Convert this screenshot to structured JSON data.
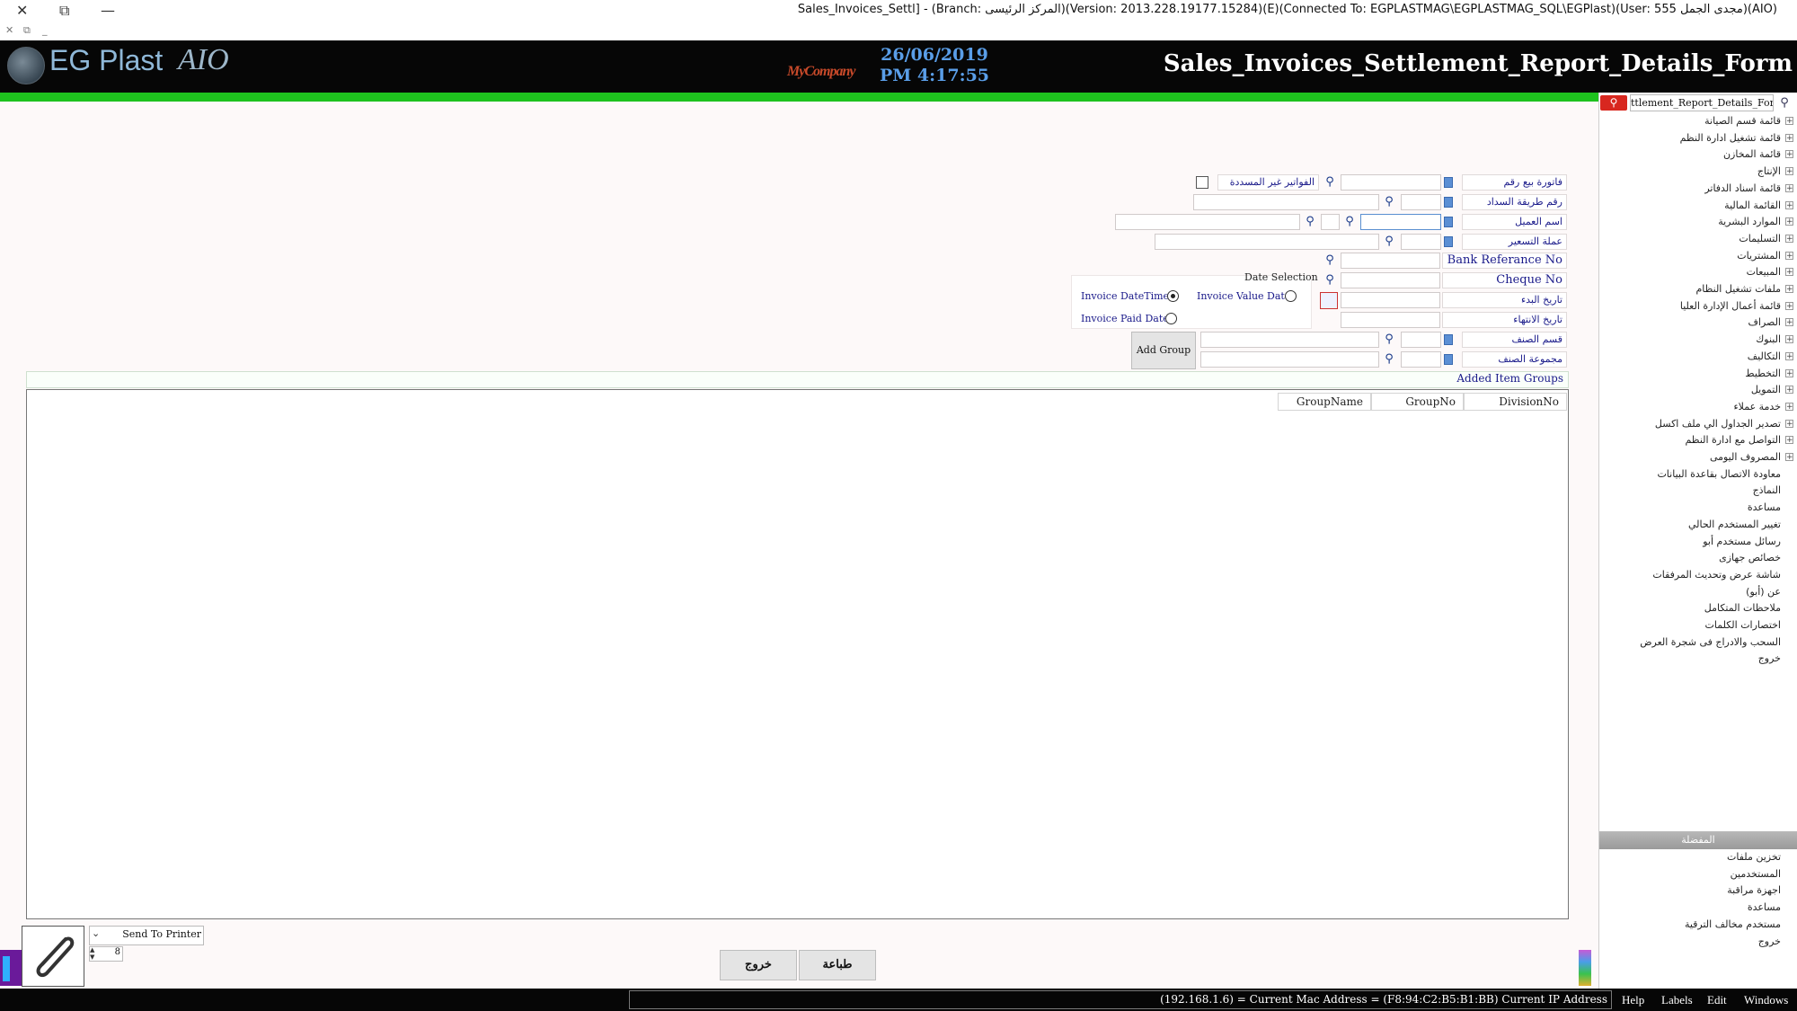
{
  "window": {
    "title": "Sales_Invoices_Settl] - (Branch: المركز الرئيسى)(Version: 2013.228.19177.15284)(E)(Connected To: EGPLASTMAG\\EGPLASTMAG_SQL\\EGPlast)(User: 555 مجدى الجمل)(AIO)",
    "close": "✕",
    "restore": "⧉",
    "minimize": "—",
    "small_close": "✕",
    "small_restore": "⧉",
    "small_min": "_"
  },
  "header": {
    "logo_text": "EG Plast",
    "logo_suffix": "AIO",
    "company_logo": "MyCompany",
    "date": "26/06/2019",
    "time": "PM 4:17:55",
    "form_title": "Sales_Invoices_Settlement_Report_Details_Form"
  },
  "form": {
    "invoice_no_label": "فاتورة بيع رقم",
    "unpaid_invoices_label": "الفواتير غير المسددة",
    "payment_method_label": "رقم طريقة السداد",
    "customer_name_label": "اسم العميل",
    "currency_label": "عملة التسعير",
    "bank_ref_label": "Bank Referance No",
    "cheque_label": "Cheque No",
    "start_date_label": "تاريخ البدء",
    "end_date_label": "تاريخ الانتهاء",
    "item_label": "قسم الصنف",
    "item_group_label": "مجموعة الصنف",
    "date_selection_label": "Date Selection",
    "radio_invoice_datetime": "Invoice DateTime",
    "radio_invoice_value_date": "Invoice Value Date",
    "radio_invoice_paid_date": "Invoice Paid Date",
    "add_group_label": "Add Group",
    "added_item_groups_label": "Added Item Groups"
  },
  "grid": {
    "columns": [
      "DivisionNo",
      "GroupNo",
      "GroupName"
    ]
  },
  "bottom": {
    "send_to_printer": "Send To Printer",
    "copies": "8",
    "print_button": "طباعة",
    "exit_button": "خروج"
  },
  "status": {
    "text": "(192.168.1.6) = Current Mac Address = (F8:94:C2:B5:B1:BB) Current IP Address",
    "menus": [
      "Help",
      "Labels",
      "Edit",
      "Windows"
    ]
  },
  "right_panel": {
    "search_value": "ttlement_Report_Details_Form",
    "menu_items": [
      "قائمة قسم الصيانة",
      "قائمة تشغيل ادارة النظم",
      "قائمة المخازن",
      "الإنتاج",
      "قائمة اسناد الدفاتر",
      "القائمة المالية",
      "الموارد البشرية",
      "التسليمات",
      "المشتريات",
      "المبيعات",
      "ملفات تشغيل النظام",
      "قائمة أعمال الإدارة العليا",
      "الصراف",
      "البنوك",
      "التكاليف",
      "التخطيط",
      "التمويل",
      "خدمة عملاء",
      "تصدير الجداول الي ملف اكسل",
      "التواصل مع ادارة النظم",
      "المصروف اليومى",
      "معاودة الاتصال بقاعدة البيانات",
      "النماذج",
      "مساعدة",
      "تغيير المستخدم الحالي",
      "رسائل مستخدم أبو",
      "خصائص جهازى",
      "شاشة عرض وتحديث المرفقات",
      "عن (أبو)",
      "ملاحظات المتكامل",
      "اختصارات الكلمات",
      "السحب والادراج فى شجرة العرض",
      "خروج"
    ],
    "favorites_title": "المفضلة",
    "favorites": [
      "تخزين ملفات",
      "المستخدمين",
      "اجهزة مراقبة",
      "مساعدة",
      "مستخدم مخالف الترقية",
      "خروج"
    ]
  }
}
